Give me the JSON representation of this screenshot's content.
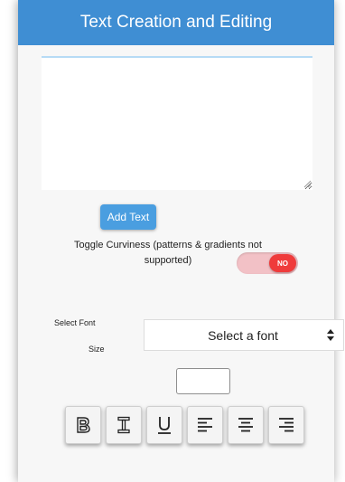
{
  "header": {
    "title": "Text Creation and Editing"
  },
  "editor": {
    "text_value": "",
    "add_text_label": "Add Text"
  },
  "curviness": {
    "label": "Toggle Curviness (patterns & gradients not supported)",
    "toggle_state": "NO"
  },
  "font": {
    "label": "Select Font",
    "selected": "Select a font"
  },
  "size": {
    "label": "Size",
    "value": ""
  },
  "formatting": {
    "buttons": [
      "bold",
      "italic",
      "underline",
      "align-left",
      "align-center",
      "align-right"
    ]
  },
  "colors": {
    "header_bg": "#3f8ed3",
    "button_bg": "#4a9ee0",
    "toggle_off": "#ef3b3b"
  }
}
